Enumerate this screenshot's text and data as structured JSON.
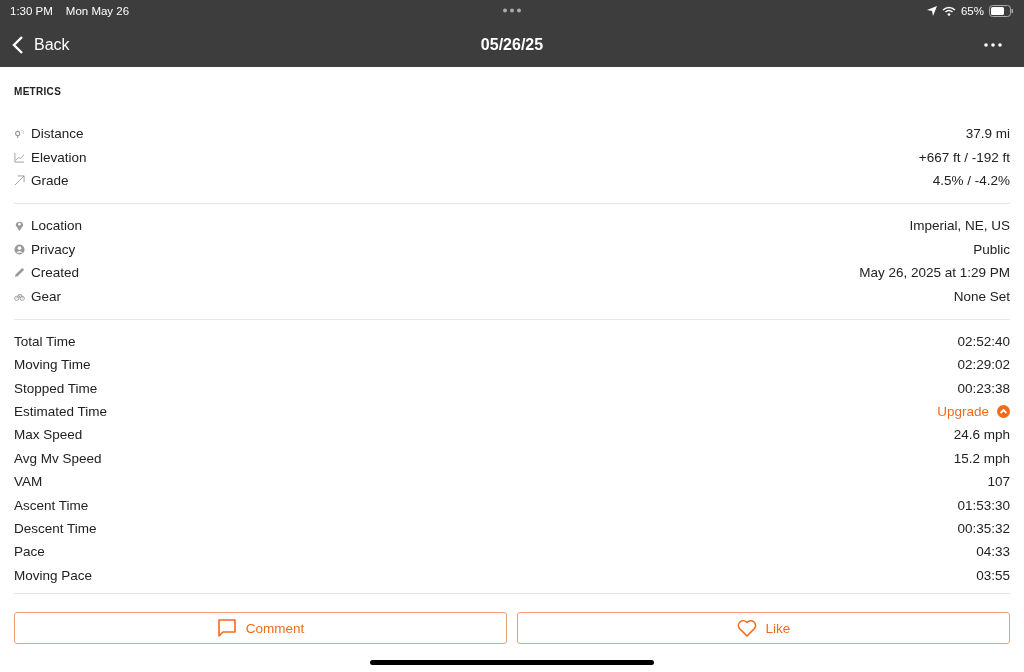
{
  "status_bar": {
    "time": "1:30 PM",
    "date": "Mon May 26",
    "battery": "65%"
  },
  "nav": {
    "back": "Back",
    "title": "05/26/25"
  },
  "metrics_title": "METRICS",
  "sections": [
    {
      "rows": [
        {
          "kind": "distance",
          "label": "Distance",
          "value": "37.9 mi"
        },
        {
          "kind": "elevation",
          "label": "Elevation",
          "value": "+667 ft / -192 ft"
        },
        {
          "kind": "grade",
          "label": "Grade",
          "value": "4.5% / -4.2%"
        }
      ]
    },
    {
      "rows": [
        {
          "kind": "location",
          "label": "Location",
          "value": "Imperial, NE, US"
        },
        {
          "kind": "privacy",
          "label": "Privacy",
          "value": "Public"
        },
        {
          "kind": "created",
          "label": "Created",
          "value": "May 26, 2025 at 1:29 PM"
        },
        {
          "kind": "gear",
          "label": "Gear",
          "value": "None Set"
        }
      ]
    },
    {
      "rows": [
        {
          "kind": "plain",
          "label": "Total Time",
          "value": "02:52:40"
        },
        {
          "kind": "plain",
          "label": "Moving Time",
          "value": "02:29:02"
        },
        {
          "kind": "plain",
          "label": "Stopped Time",
          "value": "00:23:38"
        },
        {
          "kind": "upgrade",
          "label": "Estimated Time",
          "value": "Upgrade"
        },
        {
          "kind": "plain",
          "label": "Max Speed",
          "value": "24.6 mph"
        },
        {
          "kind": "plain",
          "label": "Avg Mv Speed",
          "value": "15.2 mph"
        },
        {
          "kind": "plain",
          "label": "VAM",
          "value": "107"
        },
        {
          "kind": "plain",
          "label": "Ascent Time",
          "value": "01:53:30"
        },
        {
          "kind": "plain",
          "label": "Descent Time",
          "value": "00:35:32"
        },
        {
          "kind": "plain",
          "label": "Pace",
          "value": "04:33"
        },
        {
          "kind": "plain",
          "label": "Moving Pace",
          "value": "03:55"
        }
      ]
    }
  ],
  "buttons": [
    {
      "kind": "comment",
      "label": "Comment"
    },
    {
      "kind": "like",
      "label": "Like"
    }
  ]
}
